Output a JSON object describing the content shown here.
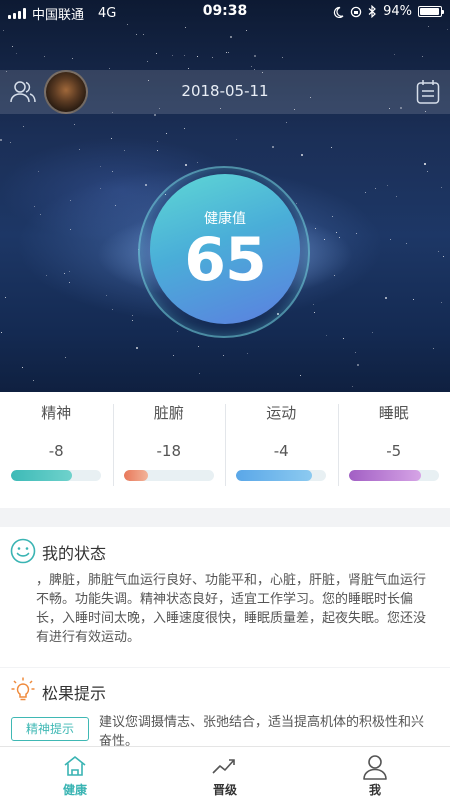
{
  "status_bar": {
    "carrier": "中国联通",
    "network": "4G",
    "time": "09:38",
    "battery": "94%",
    "battery_level": 0.94
  },
  "header": {
    "date": "2018-05-11",
    "friends_icon": "friends-icon",
    "calendar_icon": "calendar-icon"
  },
  "health": {
    "label": "健康值",
    "value": "65"
  },
  "metrics": [
    {
      "name": "精神",
      "value": "-8",
      "fill": 0.68,
      "color_from": "#3dbab7",
      "color_to": "#6fd2cc"
    },
    {
      "name": "脏腑",
      "value": "-18",
      "fill": 0.27,
      "color_from": "#e8785a",
      "color_to": "#f2b49a"
    },
    {
      "name": "运动",
      "value": "-4",
      "fill": 0.84,
      "color_from": "#5aa7e8",
      "color_to": "#8ccaf0"
    },
    {
      "name": "睡眠",
      "value": "-5",
      "fill": 0.8,
      "color_from": "#a25fc4",
      "color_to": "#d6a4e6"
    }
  ],
  "status_card": {
    "title": "我的状态",
    "text": "，脾脏，肺脏气血运行良好、功能平和，心脏，肝脏，肾脏气血运行不畅。功能失调。精神状态良好，适宜工作学习。您的睡眠时长偏长，入睡时间太晚，入睡速度很快，睡眠质量差，起夜失眠。您还没有进行有效运动。"
  },
  "tip_card": {
    "title": "松果提示",
    "badge": "精神提示",
    "text": "建议您调摄情志、张弛结合，适当提高机体的积极性和兴奋性。"
  },
  "tabs": [
    {
      "label": "健康",
      "icon": "home-icon",
      "active": true
    },
    {
      "label": "晋级",
      "icon": "trend-icon",
      "active": false
    },
    {
      "label": "我",
      "icon": "person-icon",
      "active": false
    }
  ],
  "colors": {
    "accent": "#3ab4b3",
    "circle_from": "#5fd8d5",
    "circle_to": "#5c7ee0"
  }
}
